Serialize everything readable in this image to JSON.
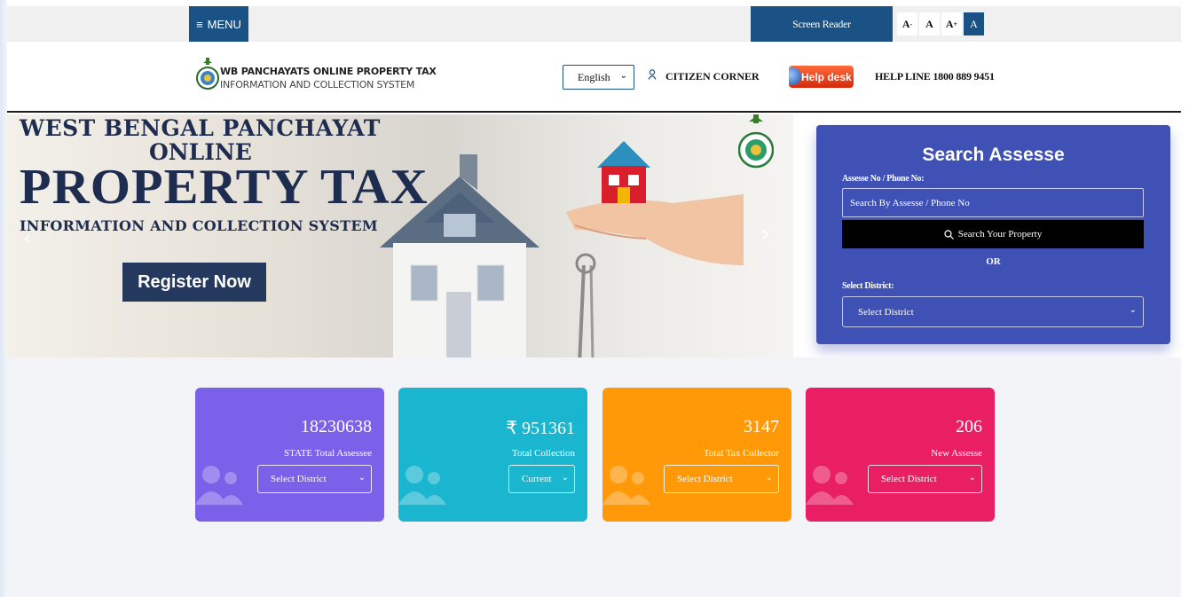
{
  "topbar": {
    "menu_label": "MENU",
    "screen_reader_label": "Screen Reader",
    "font_buttons": [
      "A-",
      "A",
      "A+",
      "A"
    ]
  },
  "header": {
    "brand_line1": "WB PANCHAYATS ONLINE PROPERTY TAX",
    "brand_line2": "INFORMATION AND COLLECTION SYSTEM",
    "language_selected": "English",
    "citizen_corner": "CITIZEN CORNER",
    "helpdesk_label": "Help desk",
    "helpline": "HELP LINE 1800 889 9451"
  },
  "hero": {
    "line1": "WEST BENGAL PANCHAYAT",
    "line2": "ONLINE",
    "line3": "PROPERTY TAX",
    "line4": "INFORMATION AND COLLECTION SYSTEM",
    "register_label": "Register Now"
  },
  "search": {
    "title": "Search Assesse",
    "assesse_label": "Assesse No / Phone No:",
    "assesse_placeholder": "Search By Assesse / Phone No",
    "search_button": "Search Your Property",
    "or_label": "OR",
    "district_label": "Select District:",
    "district_selected": "Select District"
  },
  "stats": [
    {
      "value": "18230638",
      "label": "STATE Total Assessee",
      "select": "Select District",
      "color": "#7b61ea"
    },
    {
      "value": "₹ 951361",
      "label": "Total Collection",
      "select": "Current",
      "color": "#1ab6cf"
    },
    {
      "value": "3147",
      "label": "Total Tax Collector",
      "select": "Select District",
      "color": "#ff9908"
    },
    {
      "value": "206",
      "label": "New Assesse",
      "select": "Select District",
      "color": "#ea1e63"
    }
  ],
  "colors": {
    "primary": "#1a5286",
    "search_panel": "#3f51b5",
    "hero_text": "#1e2d4f"
  }
}
